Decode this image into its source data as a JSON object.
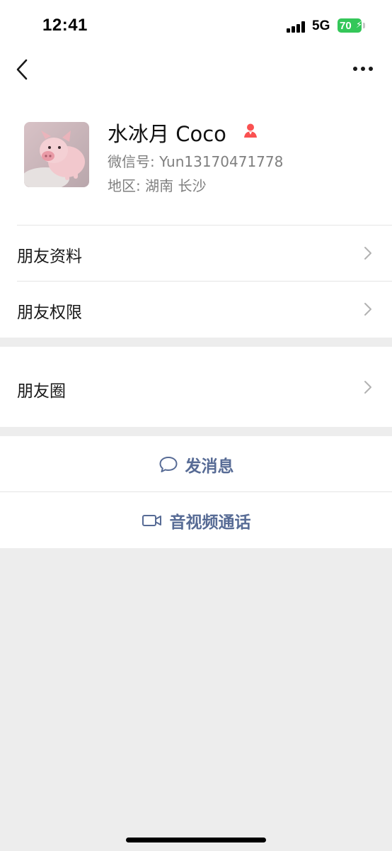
{
  "status_bar": {
    "time": "12:41",
    "network": "5G",
    "battery": "70"
  },
  "nav": {
    "back_icon": "chevron-left-icon",
    "more_icon": "ellipsis-icon"
  },
  "profile": {
    "name": "水冰月 Coco",
    "wechat_id": "微信号: Yun13170471778",
    "region": "地区: 湖南 长沙",
    "gender_icon": "female-icon",
    "gender_color": "#fa5151"
  },
  "menu": {
    "items": [
      {
        "label": "朋友资料"
      },
      {
        "label": "朋友权限"
      }
    ],
    "moments": {
      "label": "朋友圈"
    }
  },
  "actions": {
    "message": {
      "label": "发消息",
      "icon": "chat-bubble-icon"
    },
    "call": {
      "label": "音视频通话",
      "icon": "video-camera-icon"
    },
    "color": "#576b95"
  }
}
